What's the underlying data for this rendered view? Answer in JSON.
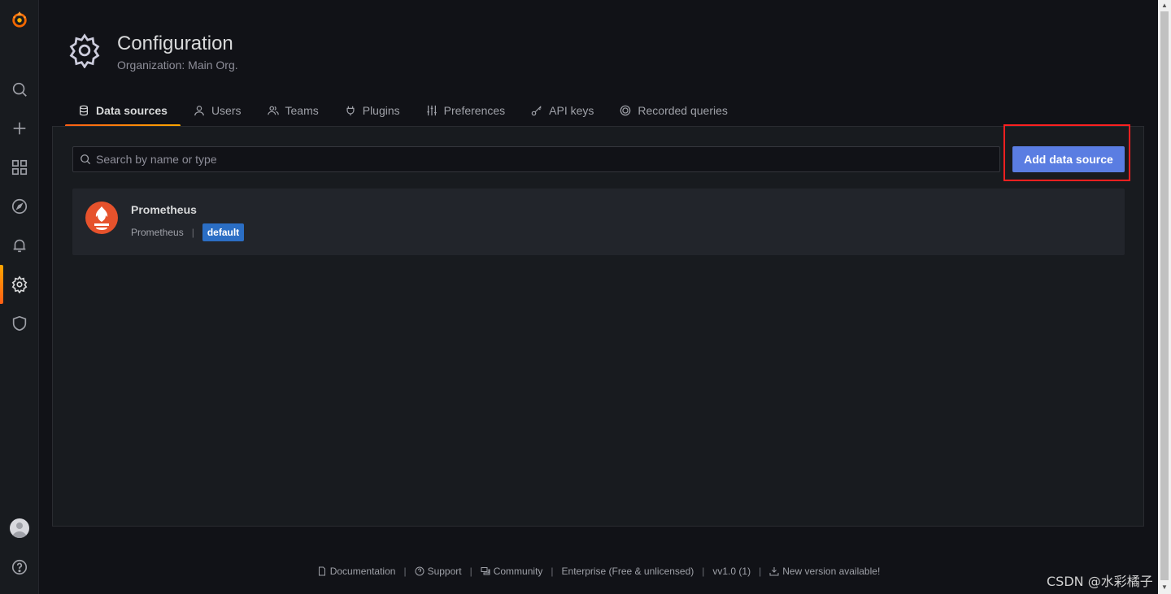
{
  "header": {
    "title": "Configuration",
    "subtitle": "Organization: Main Org."
  },
  "tabs": [
    {
      "label": "Data sources",
      "icon": "database-icon",
      "active": true
    },
    {
      "label": "Users",
      "icon": "user-icon"
    },
    {
      "label": "Teams",
      "icon": "users-icon"
    },
    {
      "label": "Plugins",
      "icon": "plug-icon"
    },
    {
      "label": "Preferences",
      "icon": "sliders-icon"
    },
    {
      "label": "API keys",
      "icon": "key-icon"
    },
    {
      "label": "Recorded queries",
      "icon": "record-icon"
    }
  ],
  "search": {
    "placeholder": "Search by name or type",
    "value": ""
  },
  "add_button": "Add data source",
  "datasources": [
    {
      "name": "Prometheus",
      "type": "Prometheus",
      "badge": "default",
      "icon": "prometheus-logo"
    }
  ],
  "footer": {
    "documentation": "Documentation",
    "support": "Support",
    "community": "Community",
    "edition": "Enterprise (Free & unlicensed)",
    "version": "vv1.0 (1)",
    "update": "New version available!"
  },
  "watermark": "CSDN @水彩橘子",
  "colors": {
    "accent": "#ff5f15",
    "primary_button": "#5a7de2",
    "badge": "#2b6ec4",
    "highlight": "#ff2020"
  }
}
